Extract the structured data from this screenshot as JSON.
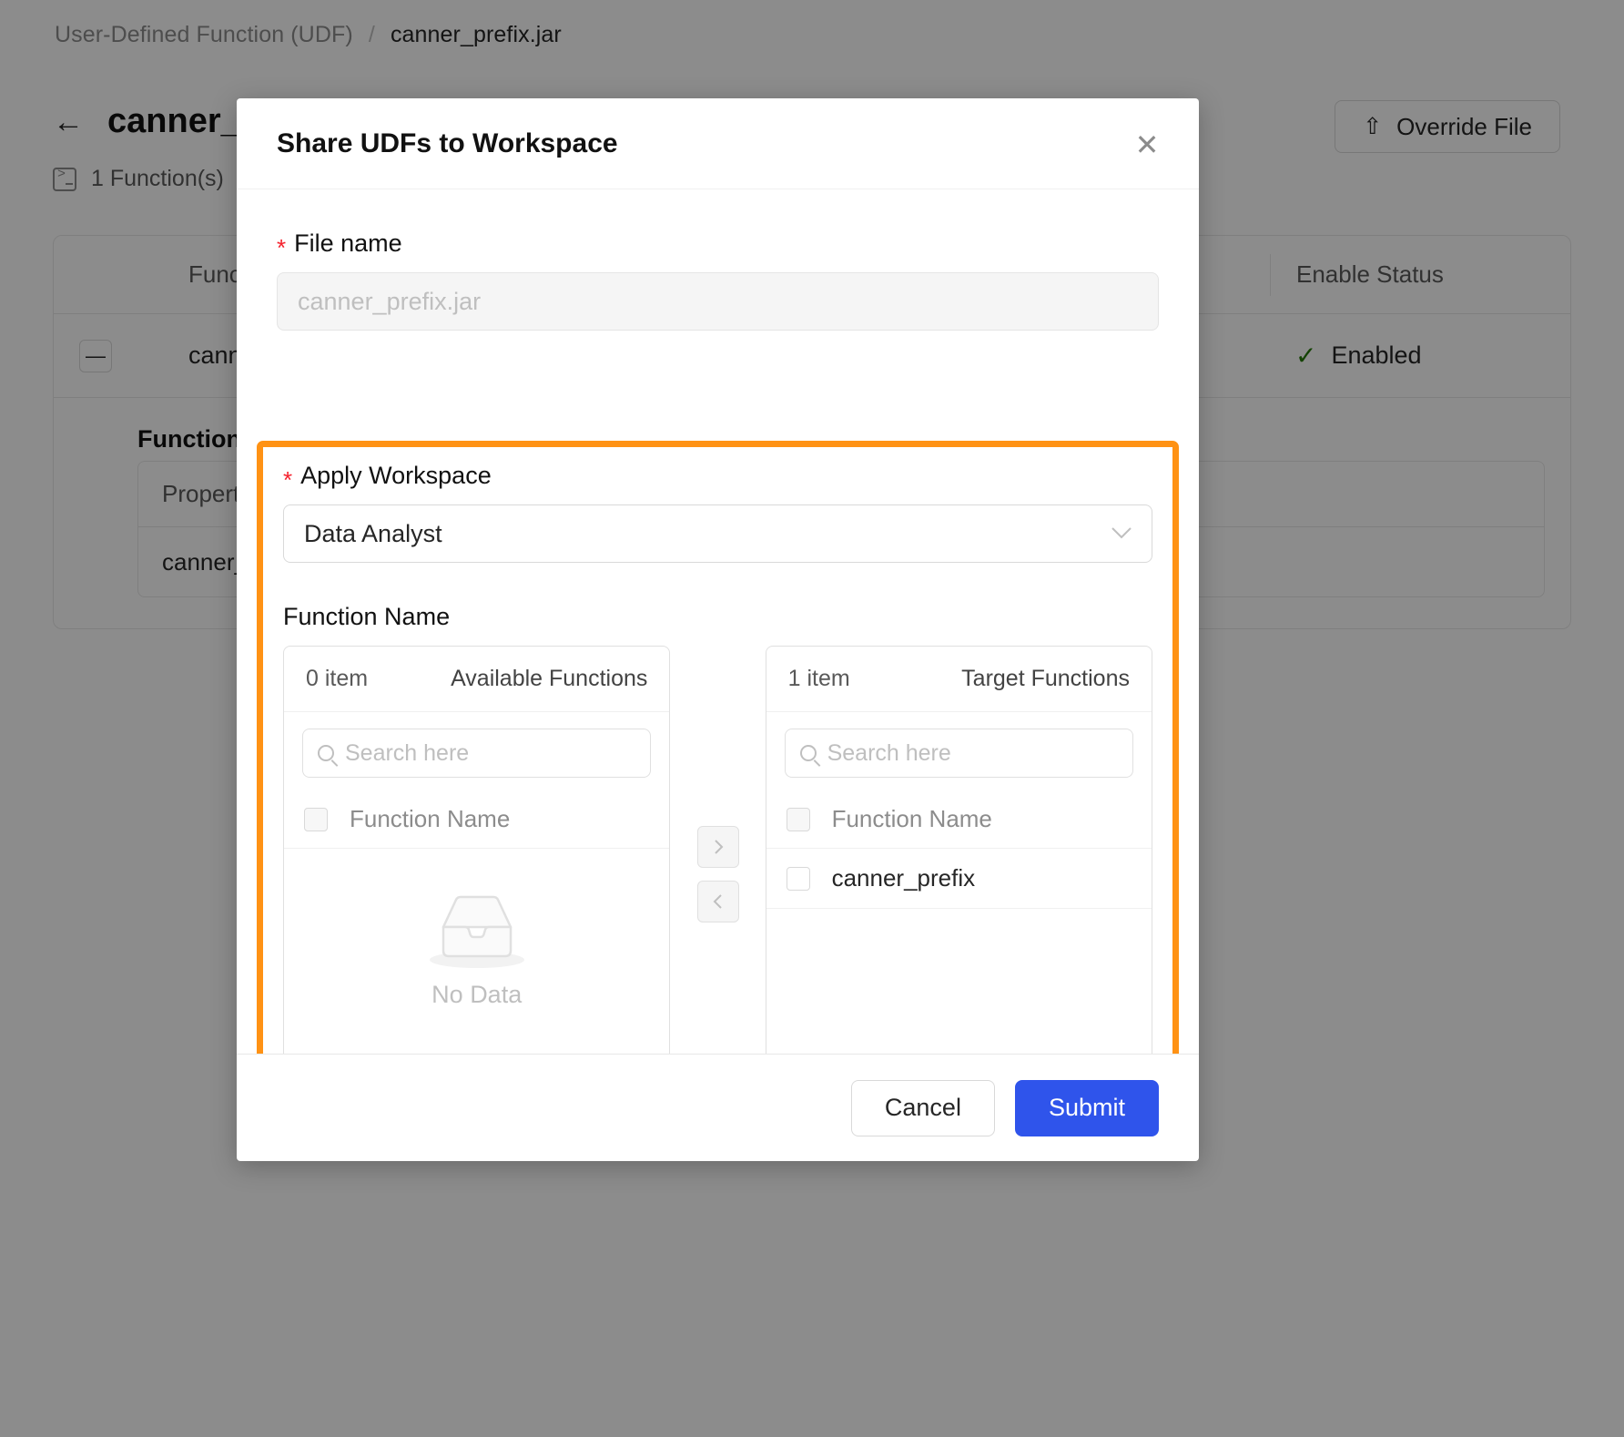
{
  "background": {
    "breadcrumb": {
      "root": "User-Defined Function (UDF)",
      "separator": "/",
      "current": "canner_prefix.jar"
    },
    "back_icon": "←",
    "page_title": "canner_prefix.jar",
    "function_count": "1 Function(s)",
    "override_button": "Override File",
    "upload_icon": "⇧",
    "table": {
      "headers": [
        "Function Name",
        "Enable Status"
      ],
      "row": {
        "collapse_icon": "—",
        "name": "canner_prefix",
        "status": "Enabled",
        "status_icon": "✓",
        "status_color": "#237804"
      },
      "detail_title": "Function Detail",
      "detail_header": "Property",
      "detail_value": "canner_prefix"
    }
  },
  "modal": {
    "title": "Share UDFs to Workspace",
    "close_icon": "✕",
    "file_name": {
      "label": "File name",
      "required_mark": "*",
      "value": "canner_prefix.jar"
    },
    "apply_workspace": {
      "label": "Apply Workspace",
      "required_mark": "*",
      "selected": "Data Analyst",
      "chevron_icon": "⌄"
    },
    "function_name_label": "Function Name",
    "transfer": {
      "available": {
        "count": "0 item",
        "title": "Available Functions",
        "search_placeholder": "Search here",
        "column_header": "Function Name",
        "items": [],
        "empty_text": "No Data"
      },
      "target": {
        "count": "1 item",
        "title": "Target Functions",
        "search_placeholder": "Search here",
        "column_header": "Function Name",
        "items": [
          "canner_prefix"
        ]
      },
      "move_right_icon": "›",
      "move_left_icon": "‹"
    },
    "footer": {
      "cancel": "Cancel",
      "submit": "Submit"
    }
  },
  "colors": {
    "highlight": "#FF9214",
    "primary": "#2f54eb",
    "required": "#f5222d"
  }
}
